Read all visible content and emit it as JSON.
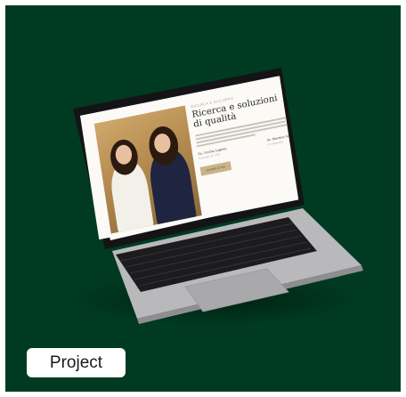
{
  "card": {
    "background": "#003a22"
  },
  "website": {
    "kicker": "RICERCA E SVILUPPO",
    "heading_line1": "Ricerca e soluzioni",
    "heading_line2": "di qualità",
    "person1_name": "Sa. Cecilia Lagana",
    "person1_role": "Founder & CEO",
    "person2_name": "Av. Martina Gibetti",
    "person2_role": "Co-Founder",
    "cta_label": "SCOPRI DI PIÙ"
  },
  "label": {
    "text": "Project"
  }
}
